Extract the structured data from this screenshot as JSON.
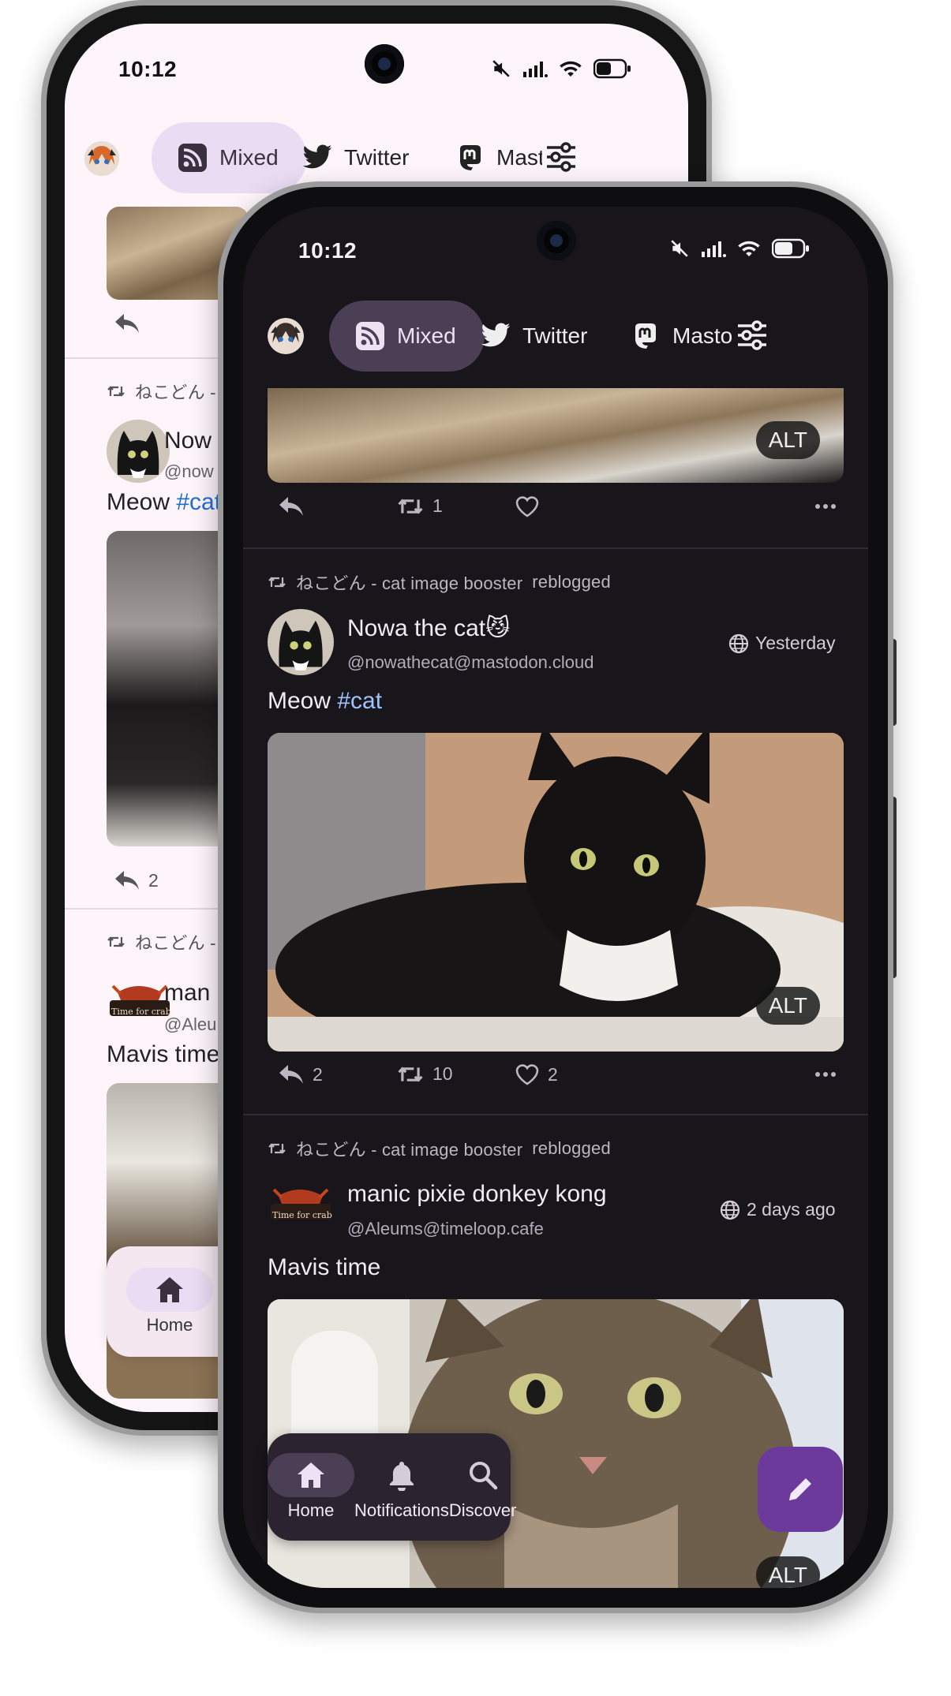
{
  "status_bar": {
    "time": "10:12"
  },
  "tabs": [
    {
      "label": "Mixed",
      "icon": "rss-icon",
      "active": true
    },
    {
      "label": "Twitter",
      "icon": "twitter-bird-icon",
      "active": false
    },
    {
      "label": "Masto",
      "icon": "mastodon-icon",
      "active": false
    }
  ],
  "filter_icon": "tune-sliders-icon",
  "top_post": {
    "alt": "ALT",
    "replies": "",
    "boosts": "1",
    "likes": ""
  },
  "posts": [
    {
      "booster": "ねこどん - cat image booster",
      "action": "reblogged",
      "author": "Nowa the cat😼",
      "handle": "@nowathecat@mastodon.cloud",
      "time": "Yesterday",
      "text": "Meow ",
      "hashtag": "#cat",
      "alt": "ALT",
      "replies": "2",
      "boosts": "10",
      "likes": "2"
    },
    {
      "booster": "ねこどん - cat image booster",
      "action": "reblogged",
      "author": "manic pixie donkey kong",
      "handle": "@Aleums@timeloop.cafe",
      "time": "2 days ago",
      "text": "Mavis time",
      "alt": "ALT"
    }
  ],
  "back_phone": {
    "boost_prefix": "ねこどん - c",
    "author1_short": "Now",
    "handle1_short": "@now",
    "text1_short": "Meow ",
    "hashtag_short": "#cat",
    "replies1": "2",
    "author2_short": "man",
    "handle2_short": "@Aleu",
    "text2_short": "Mavis time",
    "avatar2_caption": "Time for crab",
    "nav_home": "Home",
    "nav_next_short": "No"
  },
  "avatar_caption": "Time for crab",
  "bottom_nav": [
    {
      "label": "Home",
      "icon": "home-icon",
      "active": true
    },
    {
      "label": "Notifications",
      "icon": "bell-icon",
      "active": false
    },
    {
      "label": "Discover",
      "icon": "search-icon",
      "active": false
    }
  ],
  "fab_icon": "pencil-icon",
  "colors": {
    "dark_bg": "#18151b",
    "light_bg": "#fdf5fa",
    "active_tab_dark": "#4b3f55",
    "active_tab_light": "#eadcf2",
    "link": "#9ec3ff",
    "link_light": "#1f6fd1",
    "fab": "#6c3a9a"
  }
}
